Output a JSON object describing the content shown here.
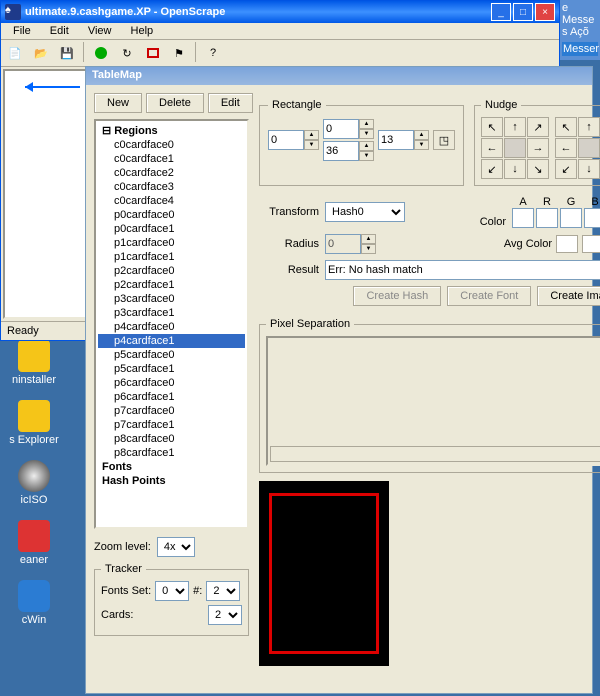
{
  "window": {
    "title": "ultimate.9.cashgame.XP - OpenScrape",
    "menu": {
      "file": "File",
      "edit": "Edit",
      "view": "View",
      "help": "Help"
    },
    "status": "Ready"
  },
  "dialog": {
    "title": "TableMap",
    "buttons": {
      "new": "New",
      "delete": "Delete",
      "edit": "Edit"
    },
    "tree": {
      "root": "Regions",
      "items": [
        "c0cardface0",
        "c0cardface1",
        "c0cardface2",
        "c0cardface3",
        "c0cardface4",
        "p0cardface0",
        "p0cardface1",
        "p1cardface0",
        "p1cardface1",
        "p2cardface0",
        "p2cardface1",
        "p3cardface0",
        "p3cardface1",
        "p4cardface0",
        "p4cardface1",
        "p5cardface0",
        "p5cardface1",
        "p6cardface0",
        "p6cardface1",
        "p7cardface0",
        "p7cardface1",
        "p8cardface0",
        "p8cardface1"
      ],
      "selected": "p4cardface1",
      "fonts": "Fonts",
      "hashpoints": "Hash Points"
    },
    "zoom": {
      "label": "Zoom level:",
      "value": "4x"
    },
    "tracker": {
      "legend": "Tracker",
      "fonts_set": "Fonts Set:",
      "fonts_set_val": "0",
      "hash_num": "#:",
      "hash_num_val": "2",
      "cards": "Cards:",
      "cards_val": "2"
    },
    "rect": {
      "legend": "Rectangle",
      "x1": "0",
      "y1": "0",
      "x2": "36",
      "y2": "13"
    },
    "nudge": {
      "legend": "Nudge"
    },
    "transform": {
      "label": "Transform",
      "value": "Hash0"
    },
    "radius": {
      "label": "Radius",
      "value": "0"
    },
    "color": {
      "label": "Color",
      "A": "A",
      "R": "R",
      "G": "G",
      "B": "B"
    },
    "avgcolor": {
      "label": "Avg Color"
    },
    "result": {
      "label": "Result",
      "value": "Err: No hash match"
    },
    "actions": {
      "hash": "Create Hash",
      "font": "Create Font",
      "image": "Create Image"
    },
    "pixsep": {
      "legend": "Pixel Separation"
    }
  },
  "desktop": {
    "icons": [
      "ninstaller",
      "s Explorer",
      "icISO",
      "eaner",
      "cWin"
    ]
  },
  "sidepanel": {
    "line1": "e Messe",
    "line2": "s Açõ",
    "line3": "Messer"
  }
}
